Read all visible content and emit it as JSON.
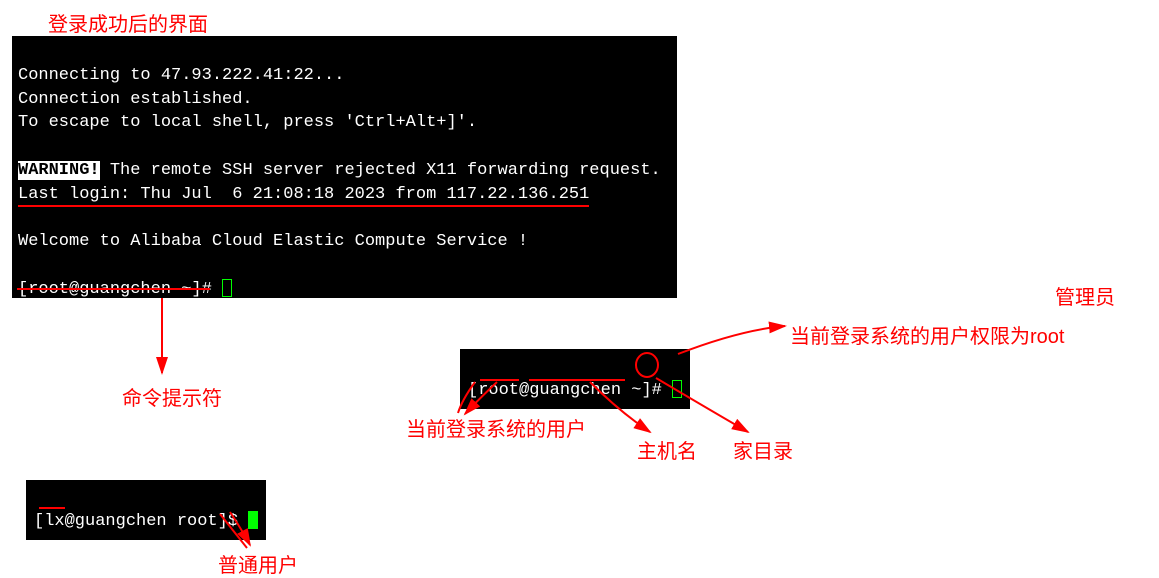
{
  "title": "登录成功后的界面",
  "terminal_main": {
    "line1": "Connecting to 47.93.222.41:22...",
    "line2": "Connection established.",
    "line3": "To escape to local shell, press 'Ctrl+Alt+]'.",
    "blank1": " ",
    "warning_label": "WARNING!",
    "warning_rest": " The remote SSH server rejected X11 forwarding request.",
    "last_login": "Last login: Thu Jul  6 21:08:18 2023 from 117.22.136.251",
    "blank2": " ",
    "welcome": "Welcome to Alibaba Cloud Elastic Compute Service !",
    "blank3": " ",
    "prompt": "[root@guangchen ~]# "
  },
  "terminal_mid": {
    "prompt_open": "[",
    "user": "root",
    "at": "@",
    "host": "guangchen",
    "space": " ",
    "dir": "~",
    "close": "]",
    "sym": "# "
  },
  "terminal_bottom": {
    "prompt": "[lx@guangchen root]$ "
  },
  "annotations": {
    "cmd_prompt": "命令提示符",
    "admin": "管理员",
    "root_perm": "当前登录系统的用户权限为root",
    "current_user": "当前登录系统的用户",
    "hostname": "主机名",
    "homedir": "家目录",
    "normal_user": "普通用户"
  }
}
